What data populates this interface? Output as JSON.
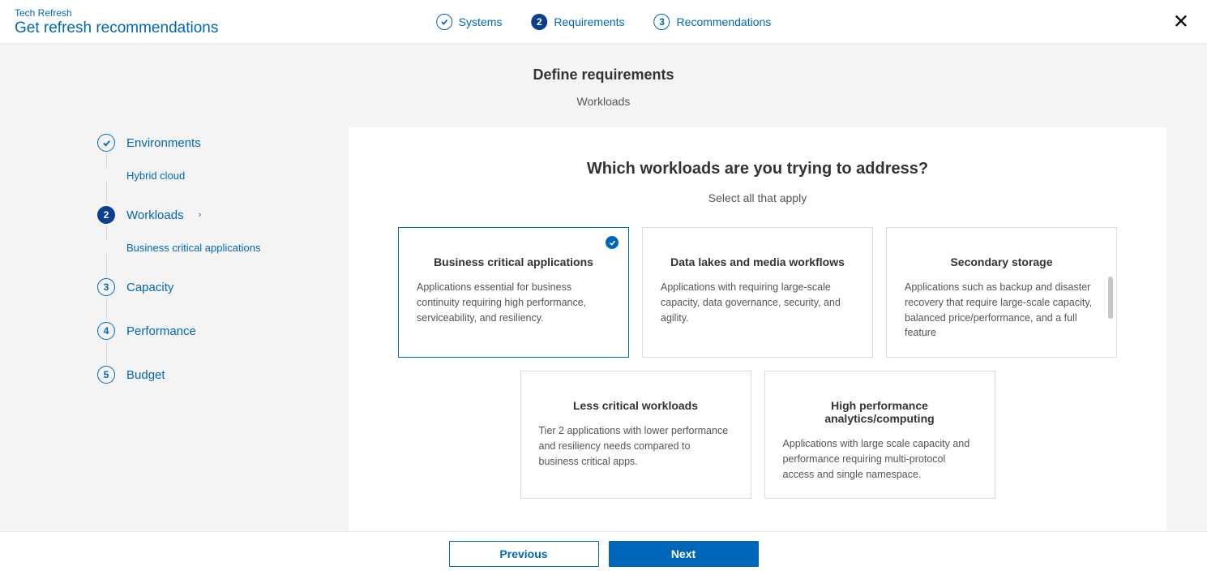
{
  "header": {
    "eyebrow": "Tech Refresh",
    "title": "Get refresh recommendations",
    "steps": [
      {
        "label": "Systems",
        "state": "done"
      },
      {
        "label": "Requirements",
        "state": "active",
        "num": "2"
      },
      {
        "label": "Recommendations",
        "state": "pending",
        "num": "3"
      }
    ]
  },
  "subheader": {
    "title": "Define requirements",
    "subtitle": "Workloads"
  },
  "sidenav": [
    {
      "label": "Environments",
      "state": "done",
      "sub": "Hybrid cloud"
    },
    {
      "label": "Workloads",
      "state": "active",
      "num": "2",
      "sub": "Business critical applications",
      "chevron": "›"
    },
    {
      "label": "Capacity",
      "state": "pending",
      "num": "3"
    },
    {
      "label": "Performance",
      "state": "pending",
      "num": "4"
    },
    {
      "label": "Budget",
      "state": "pending",
      "num": "5"
    }
  ],
  "panel": {
    "question": "Which workloads are you trying to address?",
    "instruction": "Select all that apply",
    "cards_row1": [
      {
        "title": "Business critical applications",
        "desc": "Applications essential for business continuity requiring high performance, serviceability, and resiliency.",
        "selected": true
      },
      {
        "title": "Data lakes and media workflows",
        "desc": "Applications with requiring large-scale capacity, data governance, security, and agility.",
        "selected": false
      },
      {
        "title": "Secondary storage",
        "desc": "Applications such as backup and disaster recovery that require large-scale capacity, balanced price/performance, and a full feature",
        "selected": false,
        "scrollhint": true
      }
    ],
    "cards_row2": [
      {
        "title": "Less critical workloads",
        "desc": "Tier 2 applications with lower performance and resiliency needs compared to business critical apps.",
        "selected": false
      },
      {
        "title": "High performance analytics/computing",
        "desc": "Applications with large scale capacity and performance requiring multi-protocol access and single namespace.",
        "selected": false
      }
    ]
  },
  "footer": {
    "previous": "Previous",
    "next": "Next"
  }
}
